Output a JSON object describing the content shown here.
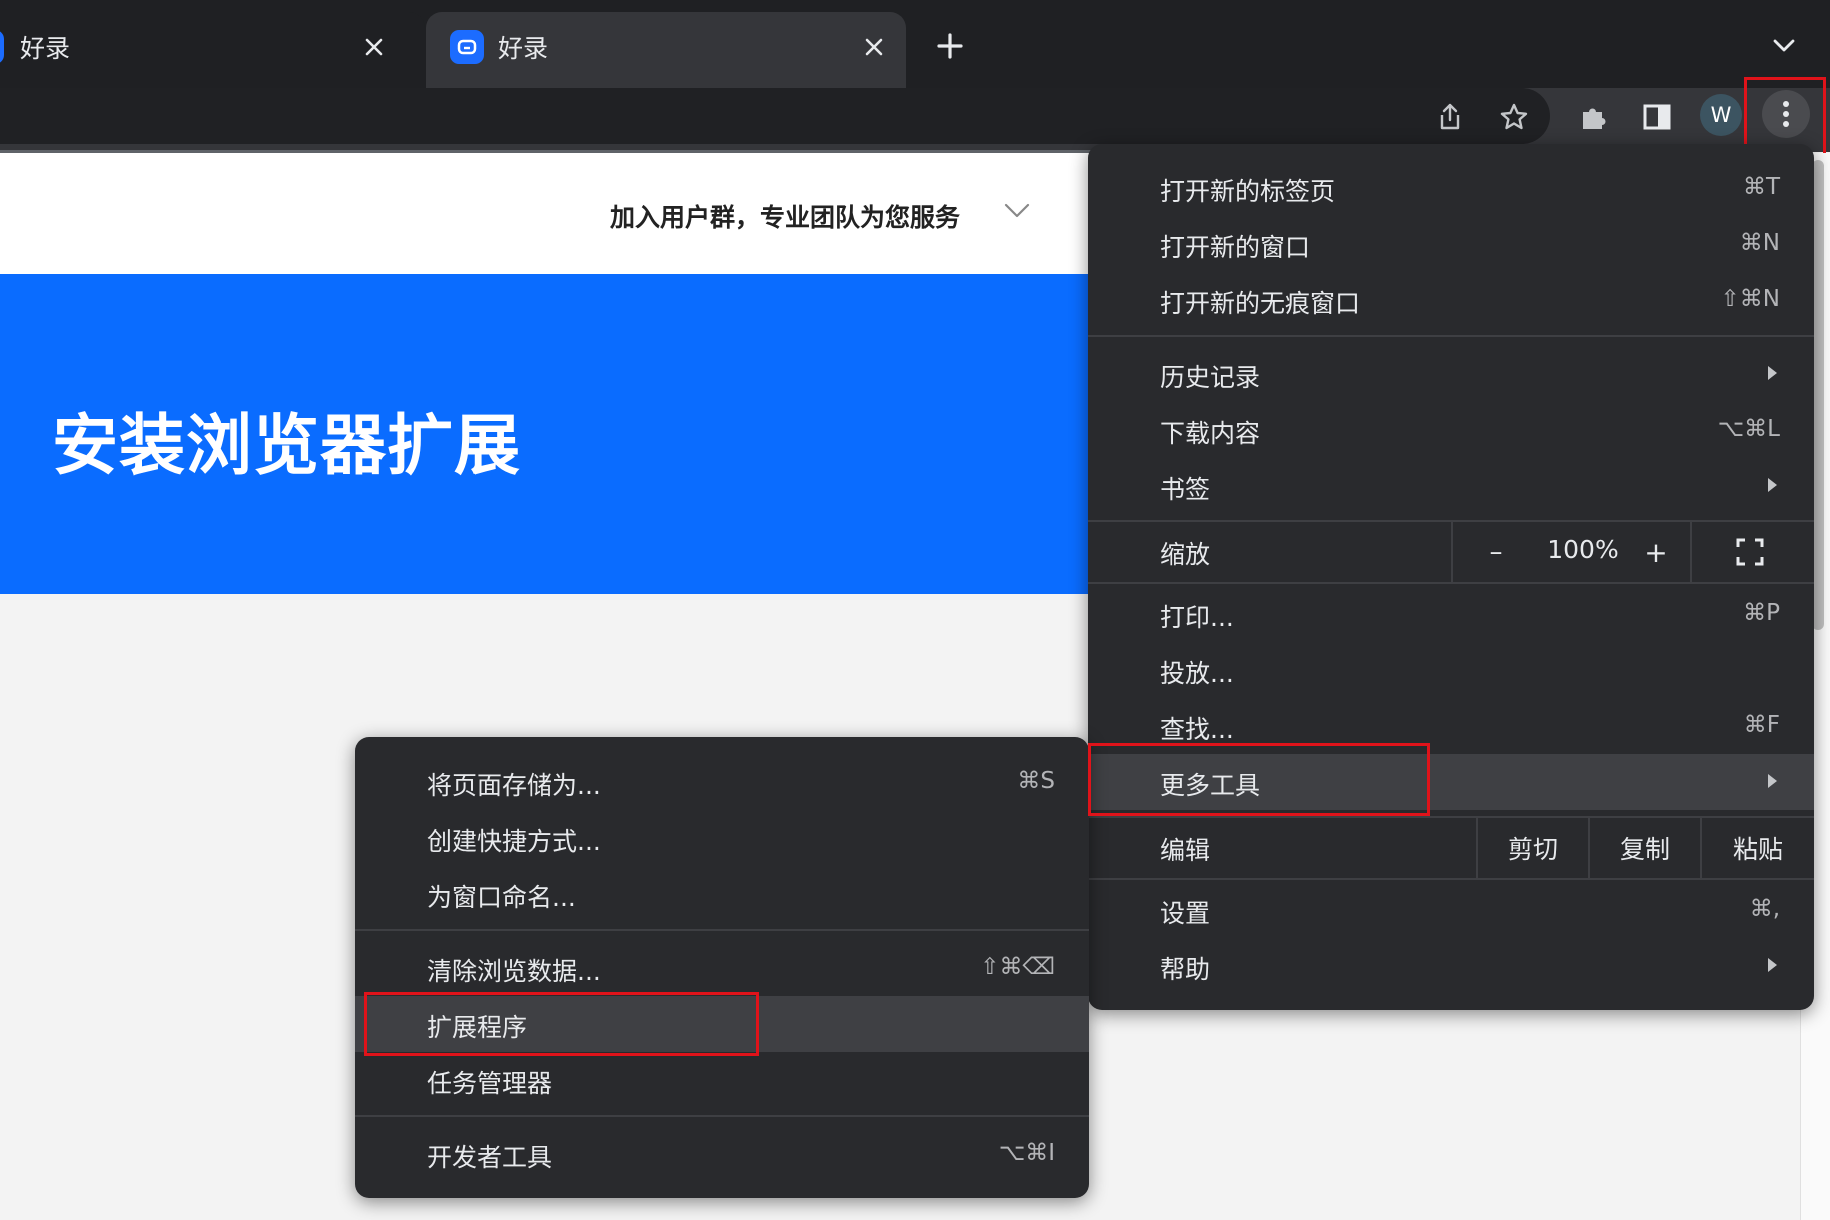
{
  "tabs": [
    {
      "title": "好录",
      "active": false
    },
    {
      "title": "好录",
      "active": true
    }
  ],
  "icons": {
    "tab_close": "close-icon",
    "new_tab": "plus-icon",
    "tab_search": "chevron-down-icon",
    "share": "share-icon",
    "bookmark": "star-icon",
    "extensions": "puzzle-icon",
    "side_panel": "side-panel-icon",
    "menu": "vertical-dots-icon",
    "submenu": "triangle-right-icon",
    "fullscreen": "fullscreen-icon"
  },
  "profile": {
    "initial": "W"
  },
  "page": {
    "header_text": "加入用户群，专业团队为您服务",
    "hero_title": "安装浏览器扩展",
    "brand_color": "#0a6cff"
  },
  "menu": {
    "new_tab": {
      "label": "打开新的标签页",
      "shortcut": "⌘T"
    },
    "new_window": {
      "label": "打开新的窗口",
      "shortcut": "⌘N"
    },
    "incognito": {
      "label": "打开新的无痕窗口",
      "shortcut": "⇧⌘N"
    },
    "history": {
      "label": "历史记录"
    },
    "downloads": {
      "label": "下载内容",
      "shortcut": "⌥⌘L"
    },
    "bookmarks": {
      "label": "书签"
    },
    "zoom": {
      "label": "缩放",
      "minus": "–",
      "value": "100%",
      "plus": "+"
    },
    "print": {
      "label": "打印...",
      "shortcut": "⌘P"
    },
    "cast": {
      "label": "投放..."
    },
    "find": {
      "label": "查找...",
      "shortcut": "⌘F"
    },
    "more_tools": {
      "label": "更多工具"
    },
    "edit": {
      "label": "编辑",
      "cut": "剪切",
      "copy": "复制",
      "paste": "粘贴"
    },
    "settings": {
      "label": "设置",
      "shortcut": "⌘,"
    },
    "help": {
      "label": "帮助"
    }
  },
  "submenu": {
    "save_page": {
      "label": "将页面存储为...",
      "shortcut": "⌘S"
    },
    "create_shortcut": {
      "label": "创建快捷方式..."
    },
    "name_window": {
      "label": "为窗口命名..."
    },
    "clear_data": {
      "label": "清除浏览数据...",
      "shortcut": "⇧⌘⌫"
    },
    "extensions": {
      "label": "扩展程序"
    },
    "task_manager": {
      "label": "任务管理器"
    },
    "dev_tools": {
      "label": "开发者工具",
      "shortcut": "⌥⌘I"
    }
  },
  "colors": {
    "highlight": "#e0131a",
    "menu_bg": "#292a2d",
    "active_item": "#3f4044"
  }
}
